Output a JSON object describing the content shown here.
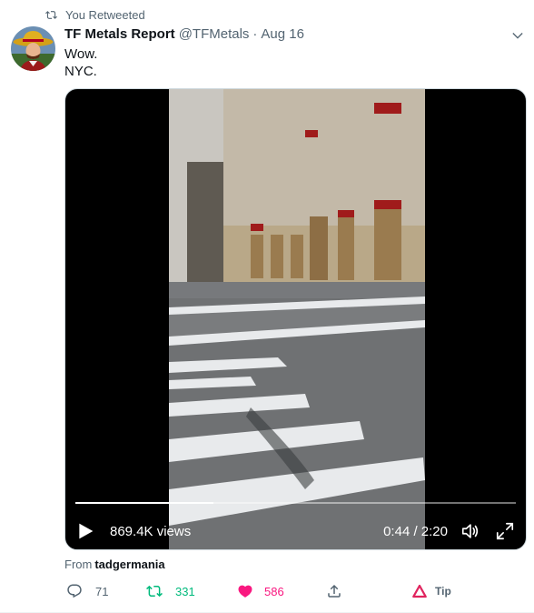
{
  "retweet_header": {
    "label": "You Retweeted",
    "icon": "retweet-icon"
  },
  "author": {
    "name": "TF Metals Report",
    "handle": "@TFMetals",
    "separator": "·",
    "date": "Aug 16"
  },
  "tweet": {
    "lines": [
      "Wow.",
      "NYC."
    ]
  },
  "video": {
    "views": "869.4K views",
    "time": "0:44 / 2:20",
    "progress_fraction": 0.314,
    "icons": [
      "play-icon",
      "volume-icon",
      "fullscreen-icon"
    ]
  },
  "source": {
    "prefix": "From",
    "user": "tadgermania"
  },
  "actions": {
    "reply_count": "71",
    "retweet_count": "331",
    "like_count": "586",
    "tip_label": "Tip"
  },
  "colors": {
    "text_primary": "#0f1419",
    "text_secondary": "#536471",
    "retweet_active": "#00ba7c",
    "like_active": "#f91880",
    "tip_red": "#e0245e"
  }
}
